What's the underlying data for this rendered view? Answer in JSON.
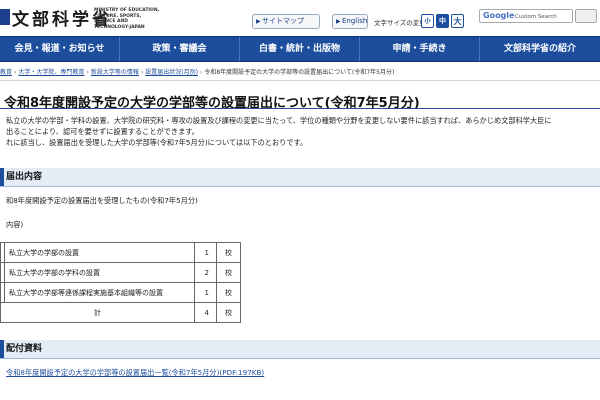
{
  "header": {
    "logo_text": "文部科学省",
    "logo_en": "MINISTRY OF EDUCATION, CULTURE, SPORTS, SCIENCE AND TECHNOLOGY-JAPAN",
    "sitemap_label": "サイトマップ",
    "english_label": "English",
    "font_size_label": "文字サイズの変更",
    "font_sizes": [
      "小",
      "中",
      "大"
    ],
    "search_brand": "Google",
    "search_placeholder": "Custom Search"
  },
  "nav": {
    "items": [
      "会見・報道・お知らせ",
      "政策・審議会",
      "白書・統計・出版物",
      "申請・手続き",
      "文部科学省の紹介"
    ]
  },
  "breadcrumb": {
    "items": [
      "教育",
      "大学・大学院、専門教育",
      "新設大学等の情報",
      "設置届出状況(月別)"
    ],
    "current": "令和8年度開設予定の大学の学部等の設置届出について(令和7年5月分)"
  },
  "title": "令和8年度開設予定の大学の学部等の設置届出について(令和7年5月分)",
  "intro": {
    "line1": "私立の大学の学部・学科の設置、大学院の研究科・専攻の設置及び課程の変更に当たって、学位の種類や分野を変更しない要件に該当すれば、あらかじめ文部科学大臣に",
    "line2": "出ることにより、認可を要せずに設置することができます。",
    "line3": "れに該当し、設置届出を受理した大学の学部等(令和7年5月分)については以下のとおりです。"
  },
  "section1": {
    "heading": "届出内容",
    "subtext": "和8年度開設予定の設置届出を受理したもの(令和7年5月分)",
    "breakdown_label": "内容)"
  },
  "table": {
    "rows": [
      {
        "label": "私立大学の学部の設置",
        "count": "1",
        "unit": "校"
      },
      {
        "label": "私立大学の学部の学科の設置",
        "count": "2",
        "unit": "校"
      },
      {
        "label": "私立大学の学部等連係課程実施基本組織等の設置",
        "count": "1",
        "unit": "校"
      }
    ],
    "total": {
      "label": "計",
      "count": "4",
      "unit": "校"
    }
  },
  "section2": {
    "heading": "配付資料",
    "link": "令和8年度開設予定の大学の学部等の設置届出一覧(令和7年5月分)(PDF:197KB)"
  },
  "colors": {
    "brand_blue": "#1d4e9e",
    "section_bg": "#e4ecf6"
  }
}
